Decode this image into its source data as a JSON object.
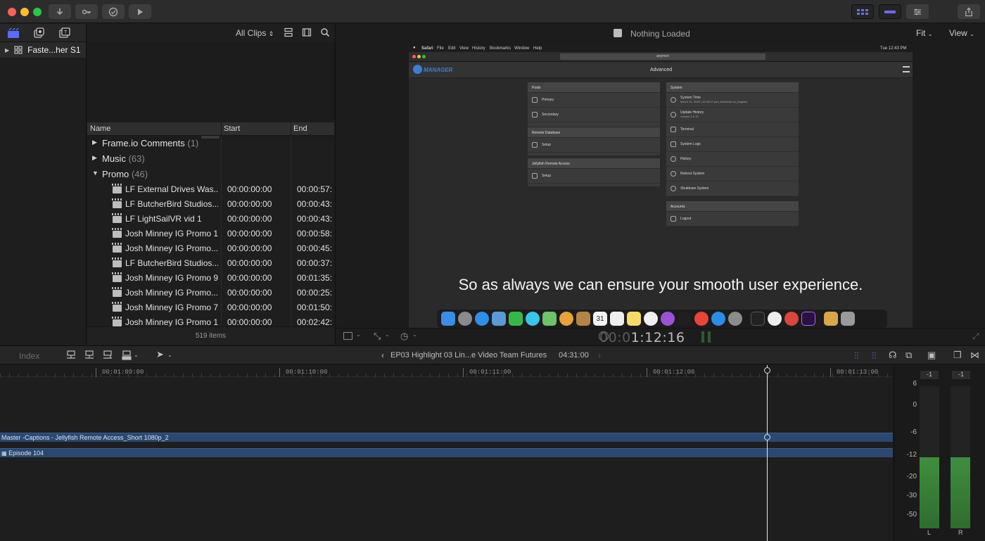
{
  "browser": {
    "library_name": "Faste...her S1",
    "filter_label": "All Clips",
    "columns": {
      "name": "Name",
      "start": "Start",
      "end": "End"
    },
    "groups": [
      {
        "name": "Frame.io Comments",
        "count": "(1)",
        "expanded": false
      },
      {
        "name": "Music",
        "count": "(63)",
        "expanded": false
      },
      {
        "name": "Promo",
        "count": "(46)",
        "expanded": true
      }
    ],
    "clips": [
      {
        "name": "LF External Drives Was...",
        "start": "00:00:00:00",
        "end": "00:00:57:"
      },
      {
        "name": "LF ButcherBird Studios...",
        "start": "00:00:00:00",
        "end": "00:00:43:"
      },
      {
        "name": "LF LightSailVR vid 1",
        "start": "00:00:00:00",
        "end": "00:00:43:"
      },
      {
        "name": "Josh Minney IG Promo 11",
        "start": "00:00:00:00",
        "end": "00:00:58:"
      },
      {
        "name": "Josh Minney IG Promo...",
        "start": "00:00:00:00",
        "end": "00:00:45:"
      },
      {
        "name": "LF ButcherBird Studios...",
        "start": "00:00:00:00",
        "end": "00:00:37:"
      },
      {
        "name": "Josh Minney IG Promo 9",
        "start": "00:00:00:00",
        "end": "00:01:35:"
      },
      {
        "name": "Josh Minney IG Promo...",
        "start": "00:00:00:00",
        "end": "00:00:25:"
      },
      {
        "name": "Josh Minney IG Promo 7",
        "start": "00:00:00:00",
        "end": "00:01:50:"
      },
      {
        "name": "Josh Minney IG Promo 1",
        "start": "00:00:00:00",
        "end": "00:02:42:"
      }
    ],
    "items_count": "519 items"
  },
  "viewer": {
    "status": "Nothing Loaded",
    "fit_label": "Fit",
    "view_label": "View",
    "timecode_dim": "00:0",
    "timecode": "1:12:16",
    "frame": {
      "app_name": "MANAGER",
      "page_title": "Advanced",
      "menu": [
        "Safari",
        "File",
        "Edit",
        "View",
        "History",
        "Bookmarks",
        "Window",
        "Help"
      ],
      "clock": "Tue 12:43 PM",
      "address": "anymon",
      "pools_title": "Pools",
      "pools": [
        "Primary",
        "Secondary"
      ],
      "remote_db_title": "Remote Database",
      "remote_db_items": [
        "Setup"
      ],
      "jellyfish_title": "Jellyfish Remote Access",
      "jellyfish_items": [
        "Setup"
      ],
      "system_title": "System",
      "system_items": [
        {
          "label": "System Time",
          "sub": "March 31, 2020 | 12:43:27 pm | America/Los_Angeles"
        },
        {
          "label": "Update History",
          "sub": "Version 1.0.70"
        },
        {
          "label": "Terminal",
          "sub": ""
        },
        {
          "label": "System Logs",
          "sub": ""
        },
        {
          "label": "History",
          "sub": ""
        },
        {
          "label": "Reboot System",
          "sub": ""
        },
        {
          "label": "Shutdown System",
          "sub": ""
        }
      ],
      "accounts_title": "Accounts",
      "accounts_items": [
        "Logout"
      ],
      "calendar_day": "31",
      "caption": "So as always we can ensure your smooth user experience."
    }
  },
  "timeline": {
    "index_label": "Index",
    "project_name": "EP03 Highlight 03 Lin...e Video Team Futures",
    "duration": "04:31:00",
    "ruler": [
      "00:01:09:00",
      "00:01:10:00",
      "00:01:11:00",
      "00:01:12:00",
      "00:01:13:00"
    ],
    "tracks": [
      {
        "label": "Master -Captions - Jellyfish Remote Access_Short 1080p_2"
      },
      {
        "label": "Episode 104"
      }
    ]
  },
  "meters": {
    "peaks": [
      "-1",
      "-1"
    ],
    "scale": [
      "6",
      "0",
      "-6",
      "-12",
      "-20",
      "-30",
      "-50"
    ],
    "channels": [
      "L",
      "R"
    ],
    "level_fraction": 0.5
  },
  "colors": {
    "accent": "#6b6bff",
    "track_blue": "#2a4870",
    "meter_green": "#3f8f3f"
  }
}
